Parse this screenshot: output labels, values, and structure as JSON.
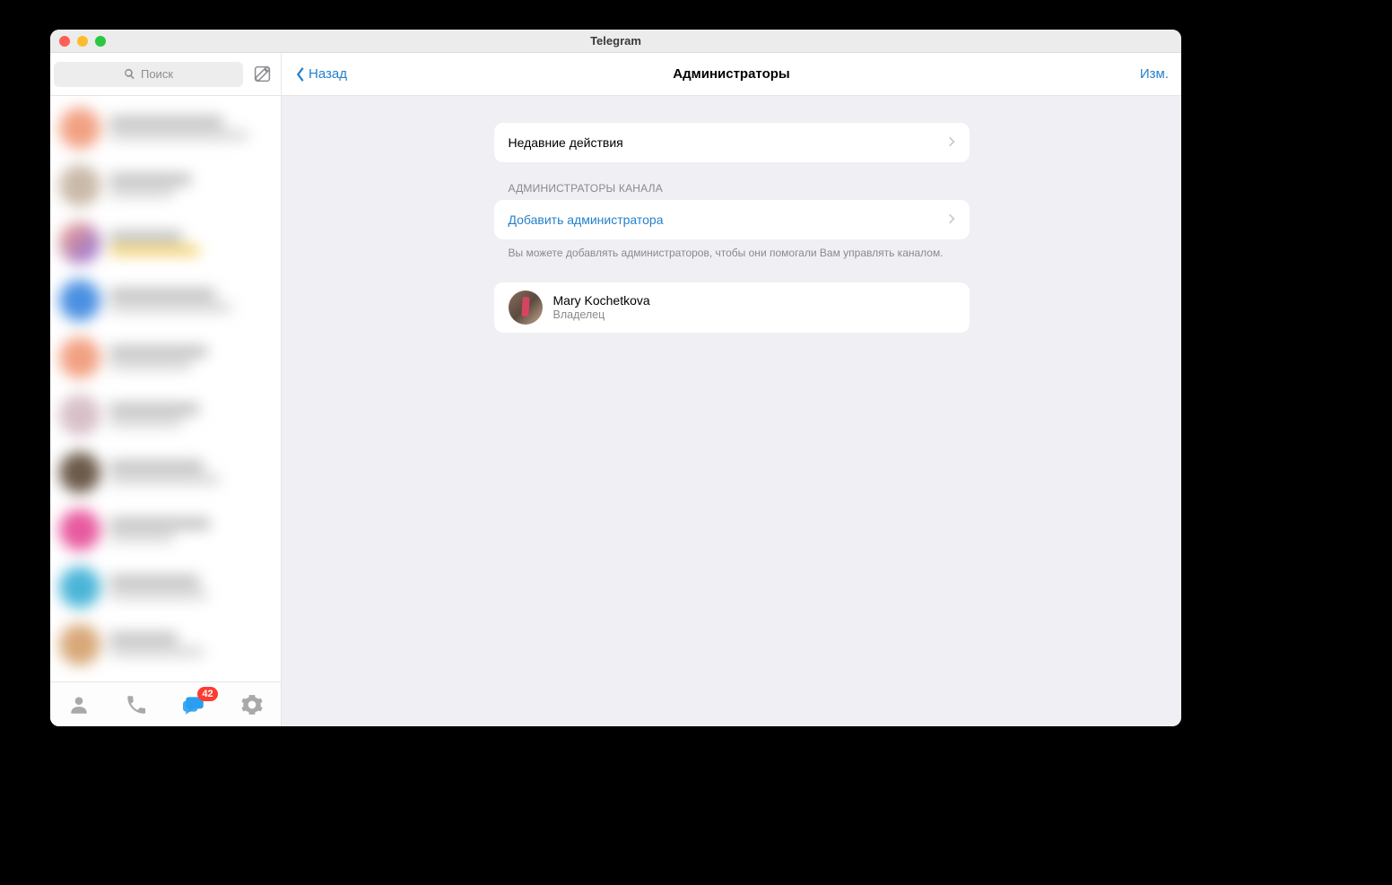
{
  "window": {
    "title": "Telegram"
  },
  "sidebar": {
    "search_placeholder": "Поиск",
    "tabs": {
      "badge_count": "42"
    }
  },
  "header": {
    "back_label": "Назад",
    "title": "Администраторы",
    "edit_label": "Изм."
  },
  "sections": {
    "recent_actions": {
      "label": "Недавние действия"
    },
    "admins": {
      "header": "АДМИНИСТРАТОРЫ КАНАЛА",
      "add_label": "Добавить администратора",
      "footer": "Вы можете добавлять администраторов, чтобы они помогали Вам управлять каналом."
    }
  },
  "admin_list": [
    {
      "name": "Mary Kochetkova",
      "role": "Владелец"
    }
  ]
}
